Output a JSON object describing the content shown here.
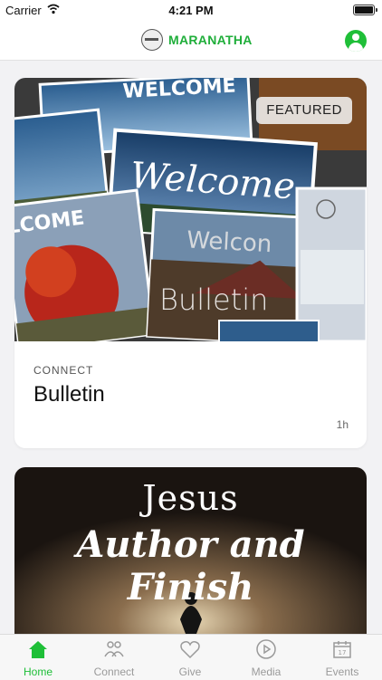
{
  "status_bar": {
    "carrier": "Carrier",
    "time": "4:21 PM"
  },
  "header": {
    "logo_text": "MARANATHA",
    "accent_color": "#1fbf38",
    "profile_icon": "person-icon"
  },
  "feed": [
    {
      "badge": "FEATURED",
      "image_text": "Bulletin",
      "category": "CONNECT",
      "title": "Bulletin",
      "time": "1h"
    },
    {
      "image_text_line1": "Jesus",
      "image_text_line2": "Author and Finish"
    }
  ],
  "tab_bar": {
    "items": [
      {
        "label": "Home",
        "icon": "home-icon",
        "active": true
      },
      {
        "label": "Connect",
        "icon": "people-icon",
        "active": false
      },
      {
        "label": "Give",
        "icon": "heart-icon",
        "active": false
      },
      {
        "label": "Media",
        "icon": "play-icon",
        "active": false
      },
      {
        "label": "Events",
        "icon": "calendar-icon",
        "active": false
      }
    ]
  }
}
